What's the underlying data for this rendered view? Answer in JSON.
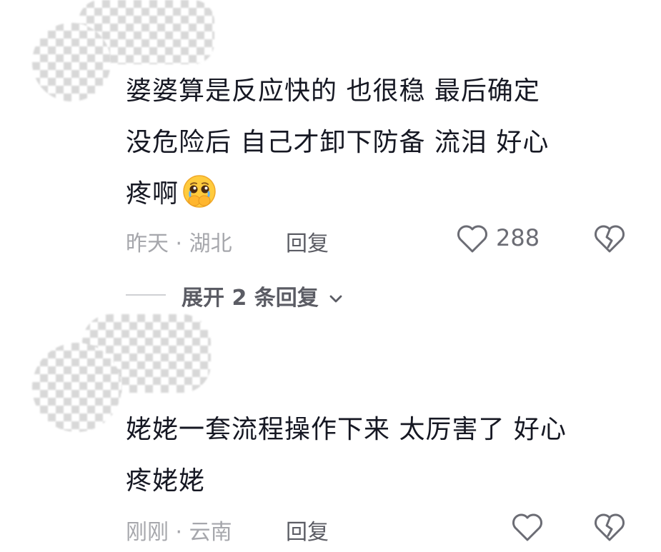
{
  "comments": [
    {
      "lines": [
        "婆婆算是反应快的 也很稳  最后确定",
        "没危险后 自己才卸下防备  流泪  好心",
        "疼啊"
      ],
      "emoji": "pleading-face-hands-emoji",
      "time": "昨天",
      "location": "湖北",
      "separator": "·",
      "reply_label": "回复",
      "like_count": "288",
      "expand_label": "展开 2 条回复"
    },
    {
      "lines": [
        "姥姥一套流程操作下来 太厉害了 好心",
        "疼姥姥"
      ],
      "time": "刚刚",
      "location": "云南",
      "separator": "·",
      "reply_label": "回复"
    }
  ],
  "icons": {
    "like": "heart-outline-icon",
    "dislike": "broken-heart-icon",
    "expand": "chevron-down-icon"
  },
  "colors": {
    "primary_text": "#161823",
    "meta_text": "#a6a7ac",
    "action_text": "#5b5c64"
  }
}
